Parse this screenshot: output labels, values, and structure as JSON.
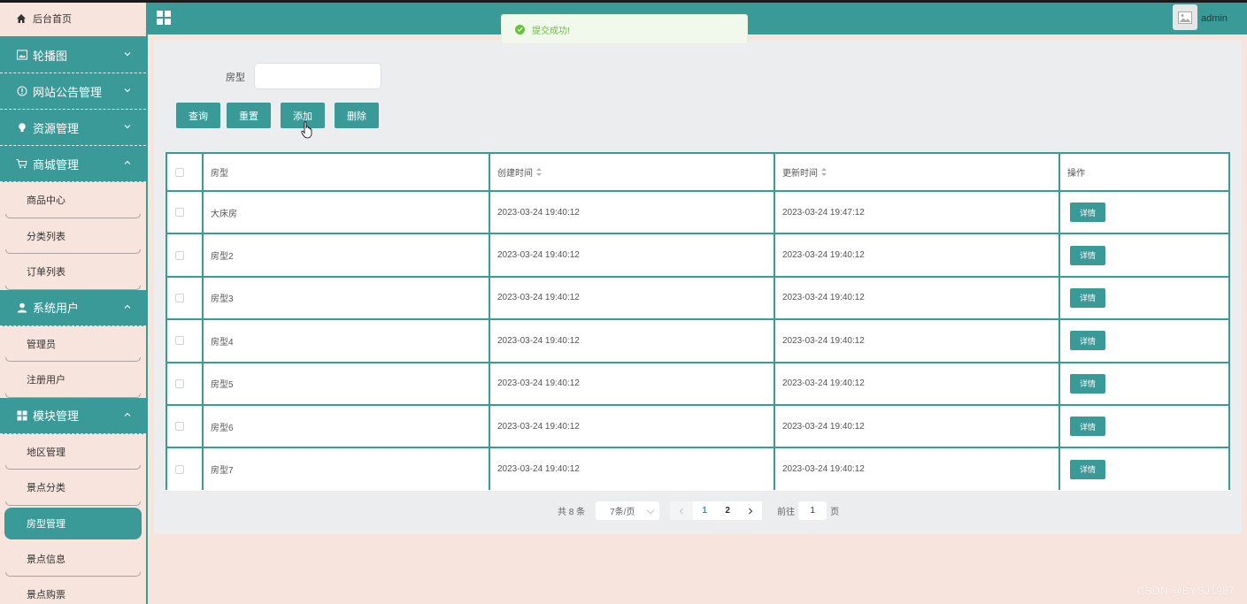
{
  "header": {
    "title": "",
    "user": "admin"
  },
  "toast": {
    "message": "提交成功!"
  },
  "sidebar": {
    "home": "后台首页",
    "groups": [
      {
        "label": "轮播图",
        "icon": "image-icon"
      },
      {
        "label": "网站公告管理",
        "icon": "info-icon"
      },
      {
        "label": "资源管理",
        "icon": "bulb-icon"
      },
      {
        "label": "商城管理",
        "icon": "cart-icon",
        "items": [
          "商品中心",
          "分类列表",
          "订单列表"
        ]
      },
      {
        "label": "系统用户",
        "icon": "user-icon",
        "items": [
          "管理员",
          "注册用户"
        ]
      },
      {
        "label": "模块管理",
        "icon": "grid-icon",
        "items": [
          "地区管理",
          "景点分类",
          "房型管理",
          "景点信息",
          "景点购票"
        ]
      }
    ]
  },
  "search": {
    "label": "房型",
    "placeholder": ""
  },
  "buttons": {
    "query": "查询",
    "reset": "重置",
    "add": "添加",
    "delete": "删除"
  },
  "table": {
    "headers": [
      "房型",
      "创建时间",
      "更新时间",
      "操作"
    ],
    "detail_label": "详情",
    "rows": [
      {
        "name": "大床房",
        "created": "2023-03-24 19:40:12",
        "updated": "2023-03-24 19:47:12"
      },
      {
        "name": "房型2",
        "created": "2023-03-24 19:40:12",
        "updated": "2023-03-24 19:40:12"
      },
      {
        "name": "房型3",
        "created": "2023-03-24 19:40:12",
        "updated": "2023-03-24 19:40:12"
      },
      {
        "name": "房型4",
        "created": "2023-03-24 19:40:12",
        "updated": "2023-03-24 19:40:12"
      },
      {
        "name": "房型5",
        "created": "2023-03-24 19:40:12",
        "updated": "2023-03-24 19:40:12"
      },
      {
        "name": "房型6",
        "created": "2023-03-24 19:40:12",
        "updated": "2023-03-24 19:40:12"
      },
      {
        "name": "房型7",
        "created": "2023-03-24 19:40:12",
        "updated": "2023-03-24 19:40:12"
      }
    ]
  },
  "pagination": {
    "total": "共 8 条",
    "page_size": "7条/页",
    "pages": [
      "1",
      "2"
    ],
    "current": "1",
    "goto_label": "前往",
    "goto_value": "1",
    "goto_suffix": "页"
  },
  "watermark": "CSDN @BYSJ1987",
  "colors": {
    "primary": "#3a9a98",
    "background": "#f7e4dc",
    "panel": "#ecedee",
    "success": "#67c23a"
  }
}
